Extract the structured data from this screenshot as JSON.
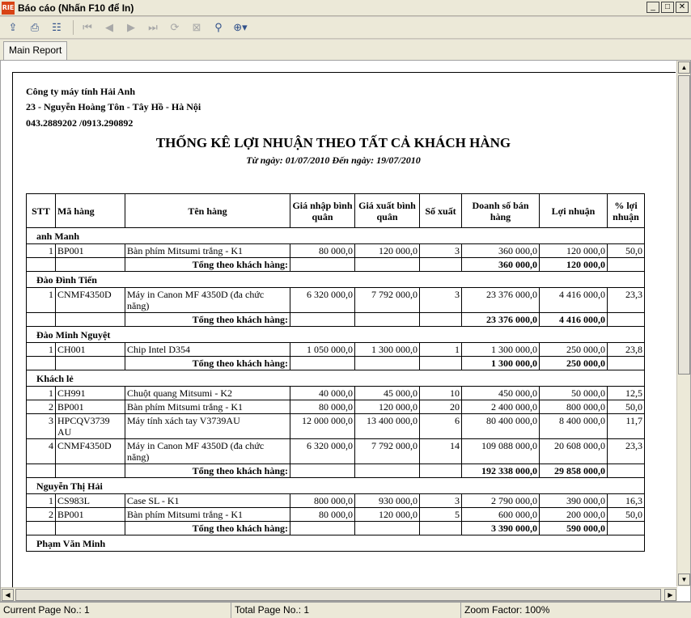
{
  "window": {
    "title": "Báo cáo (Nhấn F10 để In)",
    "icon_label": "RIE"
  },
  "toolbar": {
    "buttons": [
      "export-icon",
      "print-icon",
      "tree-icon",
      "first-page-icon",
      "prev-page-icon",
      "next-page-icon",
      "last-page-icon",
      "refresh-icon",
      "stop-icon",
      "find-icon",
      "zoom-icon"
    ]
  },
  "tabs": [
    {
      "label": "Main Report"
    }
  ],
  "report": {
    "company": "Công ty máy tính Hải Anh",
    "address": "23 - Nguyễn Hoàng Tôn - Tây Hồ - Hà Nội",
    "phone": "043.2889202 /0913.290892",
    "title": "THỐNG KÊ LỢI NHUẬN THEO TẤT CẢ KHÁCH HÀNG",
    "subtitle": "Từ ngày: 01/07/2010 Đến ngày: 19/07/2010",
    "columns": [
      "STT",
      "Mã hàng",
      "Tên hàng",
      "Giá nhập bình quân",
      "Giá xuất bình quân",
      "Số xuất",
      "Doanh số bán hàng",
      "Lợi nhuận",
      "% lợi nhuận"
    ],
    "total_label": "Tổng theo khách hàng:",
    "groups": [
      {
        "name": "anh Manh",
        "rows": [
          {
            "stt": "1",
            "code": "BP001",
            "name": "Bàn phím Mitsumi trắng - K1",
            "in_price": "80 000,0",
            "out_price": "120 000,0",
            "qty": "3",
            "sales": "360 000,0",
            "profit": "120 000,0",
            "pct": "50,0"
          }
        ],
        "total_sales": "360 000,0",
        "total_profit": "120 000,0"
      },
      {
        "name": "Đào Đình Tiến",
        "rows": [
          {
            "stt": "1",
            "code": "CNMF4350D",
            "name": "Máy in Canon MF 4350D (đa chức năng)",
            "in_price": "6 320 000,0",
            "out_price": "7 792 000,0",
            "qty": "3",
            "sales": "23 376 000,0",
            "profit": "4 416 000,0",
            "pct": "23,3"
          }
        ],
        "total_sales": "23 376 000,0",
        "total_profit": "4 416 000,0"
      },
      {
        "name": "Đào Minh Nguyệt",
        "rows": [
          {
            "stt": "1",
            "code": "CH001",
            "name": "Chip Intel D354",
            "in_price": "1 050 000,0",
            "out_price": "1 300 000,0",
            "qty": "1",
            "sales": "1 300 000,0",
            "profit": "250 000,0",
            "pct": "23,8"
          }
        ],
        "total_sales": "1 300 000,0",
        "total_profit": "250 000,0"
      },
      {
        "name": "Khách lẻ",
        "rows": [
          {
            "stt": "1",
            "code": "CH991",
            "name": "Chuột quang Mitsumi - K2",
            "in_price": "40 000,0",
            "out_price": "45 000,0",
            "qty": "10",
            "sales": "450 000,0",
            "profit": "50 000,0",
            "pct": "12,5"
          },
          {
            "stt": "2",
            "code": "BP001",
            "name": "Bàn phím Mitsumi trắng - K1",
            "in_price": "80 000,0",
            "out_price": "120 000,0",
            "qty": "20",
            "sales": "2 400 000,0",
            "profit": "800 000,0",
            "pct": "50,0"
          },
          {
            "stt": "3",
            "code": "HPCQV3739 AU",
            "name": "Máy tính xách tay V3739AU",
            "in_price": "12 000 000,0",
            "out_price": "13 400 000,0",
            "qty": "6",
            "sales": "80 400 000,0",
            "profit": "8 400 000,0",
            "pct": "11,7"
          },
          {
            "stt": "4",
            "code": "CNMF4350D",
            "name": "Máy in Canon MF 4350D (đa chức năng)",
            "in_price": "6 320 000,0",
            "out_price": "7 792 000,0",
            "qty": "14",
            "sales": "109 088 000,0",
            "profit": "20 608 000,0",
            "pct": "23,3"
          }
        ],
        "total_sales": "192 338 000,0",
        "total_profit": "29 858 000,0"
      },
      {
        "name": "Nguyễn Thị Hải",
        "rows": [
          {
            "stt": "1",
            "code": "CS983L",
            "name": "Case SL - K1",
            "in_price": "800 000,0",
            "out_price": "930 000,0",
            "qty": "3",
            "sales": "2 790 000,0",
            "profit": "390 000,0",
            "pct": "16,3"
          },
          {
            "stt": "2",
            "code": "BP001",
            "name": "Bàn phím Mitsumi trắng - K1",
            "in_price": "80 000,0",
            "out_price": "120 000,0",
            "qty": "5",
            "sales": "600 000,0",
            "profit": "200 000,0",
            "pct": "50,0"
          }
        ],
        "total_sales": "3 390 000,0",
        "total_profit": "590 000,0"
      },
      {
        "name": "Phạm Văn Minh",
        "rows": [],
        "total_sales": null,
        "total_profit": null
      }
    ]
  },
  "statusbar": {
    "current_page": "Current Page No.: 1",
    "total_page": "Total Page No.: 1",
    "zoom": "Zoom Factor: 100%"
  }
}
